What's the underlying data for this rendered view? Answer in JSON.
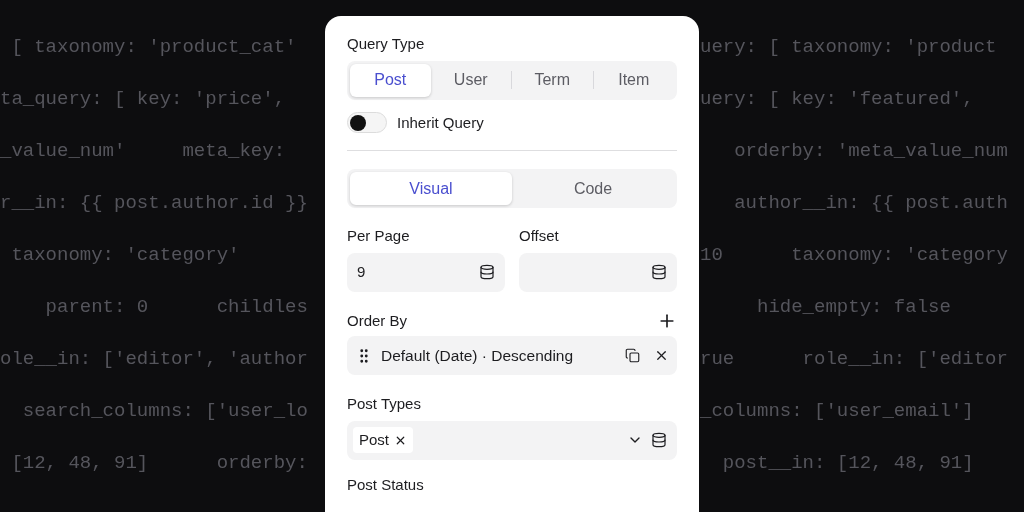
{
  "background_code": [
    {
      "left": " [ taxonomy: 'product_cat'",
      "right": "uery: [ taxonomy: 'product"
    },
    {
      "left": "ta_query: [ key: 'price',",
      "right": "uery: [ key: 'featured',"
    },
    {
      "left": "_value_num'     meta_key:",
      "right": "   orderby: 'meta_value_num"
    },
    {
      "left": "r__in: {{ post.author.id }}",
      "right": "   author__in: {{ post.auth"
    },
    {
      "left": " taxonomy: 'category'",
      "right": "10      taxonomy: 'category"
    },
    {
      "left": "    parent: 0      childles",
      "right": "     hide_empty: false"
    },
    {
      "left": "ole__in: ['editor', 'author",
      "right": "rue      role__in: ['editor"
    },
    {
      "left": "  search_columns: ['user_lo",
      "right": "_columns: ['user_email']"
    },
    {
      "left": " [12, 48, 91]      orderby:",
      "right": "  post__in: [12, 48, 91]"
    }
  ],
  "panel": {
    "query_type": {
      "label": "Query Type",
      "tabs": [
        {
          "label": "Post",
          "selected": true
        },
        {
          "label": "User",
          "selected": false
        },
        {
          "label": "Term",
          "selected": false
        },
        {
          "label": "Item",
          "selected": false
        }
      ]
    },
    "inherit_query": {
      "label": "Inherit Query",
      "on": false
    },
    "mode_tabs": [
      {
        "label": "Visual",
        "selected": true
      },
      {
        "label": "Code",
        "selected": false
      }
    ],
    "per_page": {
      "label": "Per Page",
      "value": "9"
    },
    "offset": {
      "label": "Offset"
    },
    "order_by": {
      "label": "Order By",
      "items": [
        "Default (Date) · Descending"
      ]
    },
    "post_types": {
      "label": "Post Types",
      "chips": [
        "Post"
      ]
    },
    "post_status": {
      "label": "Post Status"
    }
  }
}
